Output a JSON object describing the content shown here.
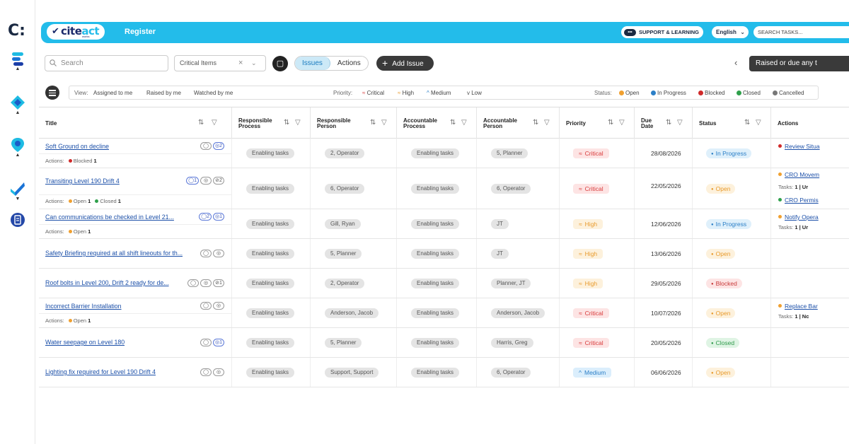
{
  "rail": {
    "logo": "C:",
    "items": [
      {
        "icon": "layers-icon",
        "caret": "▲",
        "color": "#1ebbe3"
      },
      {
        "icon": "diamond-icon",
        "caret": "▲",
        "color": "#1ebbe3"
      },
      {
        "icon": "location-pin-icon",
        "caret": "▲",
        "color": "#1ebbe3"
      },
      {
        "icon": "checkmark-icon",
        "caret": "▼",
        "color": "#1a73d6"
      },
      {
        "icon": "register-book-icon",
        "caret": "",
        "color": "#2448a8"
      }
    ]
  },
  "header": {
    "brand": "cite",
    "brand_accent": "act",
    "brand_sub": "works",
    "title": "Register",
    "support_label": "SUPPORT & LEARNING",
    "language": "English",
    "task_search_placeholder": "SEARCH TASKS..."
  },
  "toolbar": {
    "search_placeholder": "Search",
    "filter_value": "Critical Items",
    "tabs": [
      "Issues",
      "Actions"
    ],
    "active_tab": "Issues",
    "add_issue_label": "Add Issue",
    "raised_label": "Raised or due any t"
  },
  "filters": {
    "view_label": "View:",
    "views": [
      "Assigned to me",
      "Raised by me",
      "Watched by me"
    ],
    "priority_label": "Priority:",
    "priorities": [
      {
        "label": "Critical",
        "glyph": "≈",
        "color": "#d83b3b"
      },
      {
        "label": "High",
        "glyph": "≈",
        "color": "#e89a2c"
      },
      {
        "label": "Medium",
        "glyph": "^",
        "color": "#2b7fc7"
      },
      {
        "label": "Low",
        "glyph": "v",
        "color": "#555555"
      }
    ],
    "status_label": "Status:",
    "statuses": [
      {
        "label": "Open",
        "color": "#f0a030"
      },
      {
        "label": "In Progress",
        "color": "#2b7fc7"
      },
      {
        "label": "Blocked",
        "color": "#d02a2a"
      },
      {
        "label": "Closed",
        "color": "#2fa04b"
      },
      {
        "label": "Cancelled",
        "color": "#777777"
      }
    ]
  },
  "columns": [
    {
      "key": "title",
      "label": "Title"
    },
    {
      "key": "rproc",
      "label": "Responsible Process"
    },
    {
      "key": "rpers",
      "label": "Responsible Person"
    },
    {
      "key": "aproc",
      "label": "Accountable Process"
    },
    {
      "key": "apers",
      "label": "Accountable Person"
    },
    {
      "key": "priority",
      "label": "Priority"
    },
    {
      "key": "due",
      "label": "Due Date"
    },
    {
      "key": "status",
      "label": "Status"
    },
    {
      "key": "actions",
      "label": "Actions"
    }
  ],
  "rows": [
    {
      "title": "Soft Ground on decline",
      "icons": [
        {
          "sym": "◯",
          "hl": false
        },
        {
          "sym": "◎2",
          "hl": true
        }
      ],
      "sub": {
        "label": "Actions:",
        "items": [
          {
            "label": "Blocked",
            "count": "1",
            "color": "#d02a2a"
          }
        ]
      },
      "rproc": "Enabling tasks",
      "rpers": "2, Operator",
      "aproc": "Enabling tasks",
      "apers": "5, Planner",
      "priority": "Critical",
      "prio_class": "critical",
      "prio_glyph": "≈",
      "due": "28/08/2026",
      "status": "In Progress",
      "status_class": "progress",
      "status_glyph": "●",
      "actions": [
        {
          "label": "Review Situa",
          "color": "#d02a2a"
        }
      ],
      "tasks": ""
    },
    {
      "title": "Transiting Level 190 Drift 4",
      "icons": [
        {
          "sym": "◯1",
          "hl": true
        },
        {
          "sym": "◎",
          "hl": false
        },
        {
          "sym": "⊘2",
          "hl": false
        }
      ],
      "sub": {
        "label": "Actions:",
        "items": [
          {
            "label": "Open",
            "count": "1",
            "color": "#f0a030"
          },
          {
            "label": "Closed",
            "count": "1",
            "color": "#2fa04b"
          }
        ]
      },
      "rproc": "Enabling tasks",
      "rpers": "6, Operator",
      "aproc": "Enabling tasks",
      "apers": "6, Operator",
      "priority": "Critical",
      "prio_class": "critical",
      "prio_glyph": "≈",
      "due": "22/05/2026",
      "status": "Open",
      "status_class": "open",
      "status_glyph": "●",
      "actions": [
        {
          "label": "CRO Movem",
          "color": "#f0a030"
        },
        {
          "label": "CRO Permis",
          "color": "#2fa04b"
        }
      ],
      "tasks": "1 | Ur"
    },
    {
      "title": "Can communications be checked in Level 21...",
      "icons": [
        {
          "sym": "◯2",
          "hl": true
        },
        {
          "sym": "◎1",
          "hl": true
        }
      ],
      "sub": {
        "label": "Actions:",
        "items": [
          {
            "label": "Open",
            "count": "1",
            "color": "#f0a030"
          }
        ]
      },
      "rproc": "Enabling tasks",
      "rpers": "Gill, Ryan",
      "aproc": "Enabling tasks",
      "apers": "JT",
      "priority": "High",
      "prio_class": "high",
      "prio_glyph": "≈",
      "due": "12/06/2026",
      "status": "In Progress",
      "status_class": "progress",
      "status_glyph": "●",
      "actions": [
        {
          "label": "Notify Opera",
          "color": "#f0a030"
        }
      ],
      "tasks": "1 | Ur"
    },
    {
      "title": "Safety Briefing required at all shift lineouts for th...",
      "icons": [
        {
          "sym": "◯",
          "hl": false
        },
        {
          "sym": "◎",
          "hl": false
        }
      ],
      "sub": null,
      "rproc": "Enabling tasks",
      "rpers": "5, Planner",
      "aproc": "Enabling tasks",
      "apers": "JT",
      "priority": "High",
      "prio_class": "high",
      "prio_glyph": "≈",
      "due": "13/06/2026",
      "status": "Open",
      "status_class": "open",
      "status_glyph": "●",
      "actions": [],
      "tasks": ""
    },
    {
      "title": "Roof bolts in Level 200, Drift 2 ready for de...",
      "icons": [
        {
          "sym": "◯",
          "hl": false
        },
        {
          "sym": "◎",
          "hl": false
        },
        {
          "sym": "⊘1",
          "hl": false
        }
      ],
      "sub": null,
      "rproc": "Enabling tasks",
      "rpers": "2, Operator",
      "aproc": "Enabling tasks",
      "apers": "Planner, JT",
      "priority": "High",
      "prio_class": "high",
      "prio_glyph": "≈",
      "due": "29/05/2026",
      "status": "Blocked",
      "status_class": "blocked",
      "status_glyph": "●",
      "actions": [],
      "tasks": ""
    },
    {
      "title": "Incorrect Barrier Installation",
      "icons": [
        {
          "sym": "◯",
          "hl": false
        },
        {
          "sym": "◎",
          "hl": false
        }
      ],
      "sub": {
        "label": "Actions:",
        "items": [
          {
            "label": "Open",
            "count": "1",
            "color": "#f0a030"
          }
        ]
      },
      "rproc": "Enabling tasks",
      "rpers": "Anderson, Jacob",
      "aproc": "Enabling tasks",
      "apers": "Anderson, Jacob",
      "priority": "Critical",
      "prio_class": "critical",
      "prio_glyph": "≈",
      "due": "10/07/2026",
      "status": "Open",
      "status_class": "open",
      "status_glyph": "●",
      "actions": [
        {
          "label": "Replace Bar",
          "color": "#f0a030"
        }
      ],
      "tasks": "1 | Nc"
    },
    {
      "title": "Water seepage on Level 180",
      "icons": [
        {
          "sym": "◯",
          "hl": false
        },
        {
          "sym": "◎1",
          "hl": true
        }
      ],
      "sub": null,
      "rproc": "Enabling tasks",
      "rpers": "5, Planner",
      "aproc": "Enabling tasks",
      "apers": "Harris, Greg",
      "priority": "Critical",
      "prio_class": "critical",
      "prio_glyph": "≈",
      "due": "20/05/2026",
      "status": "Closed",
      "status_class": "closed",
      "status_glyph": "●",
      "actions": [],
      "tasks": ""
    },
    {
      "title": "Lighting fix required for Level 190 Drift 4",
      "icons": [
        {
          "sym": "◯",
          "hl": false
        },
        {
          "sym": "◎",
          "hl": false
        }
      ],
      "sub": null,
      "rproc": "Enabling tasks",
      "rpers": "Support, Support",
      "aproc": "Enabling tasks",
      "apers": "6, Operator",
      "priority": "Medium",
      "prio_class": "medium",
      "prio_glyph": "^",
      "due": "06/06/2026",
      "status": "Open",
      "status_class": "open",
      "status_glyph": "●",
      "actions": [],
      "tasks": ""
    }
  ]
}
